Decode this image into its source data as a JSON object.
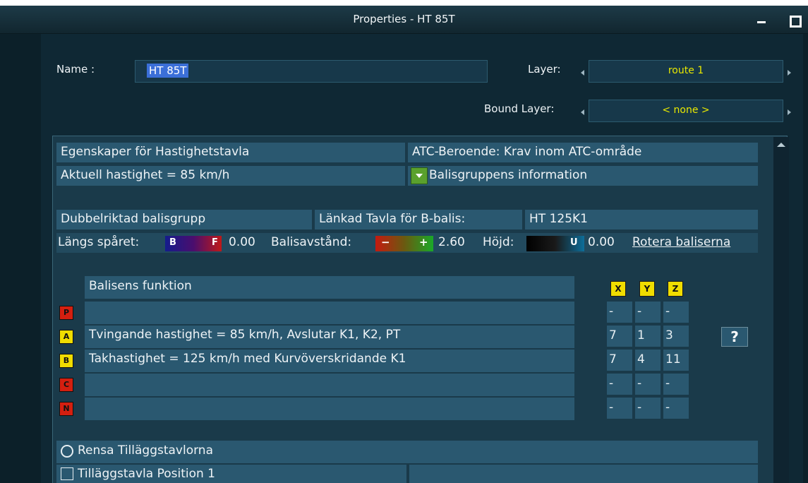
{
  "window": {
    "title": "Properties - HT 85T"
  },
  "header": {
    "name_label": "Name :",
    "name_value": "HT 85T",
    "layer_label": "Layer:",
    "layer_value": "route 1",
    "bound_layer_label": "Bound Layer:",
    "bound_layer_value": "< none >"
  },
  "sign": {
    "properties_title": "Egenskaper för Hastighetstavla",
    "atc_dependency": "ATC-Beroende:  Krav inom ATC-område",
    "current_speed": "Aktuell hastighet = 85 km/h",
    "balise_group_info": "Balisgruppens information",
    "double_direction": "Dubbelriktad balisgrupp",
    "linked_sign_label": "Länkad Tavla för B-balis:",
    "linked_sign_value": "HT 125K1",
    "along_track_label": "Längs spåret:",
    "along_track_value": "0.00",
    "balise_distance_label": "Balisavstånd:",
    "balise_distance_value": "2.60",
    "height_label": "Höjd:",
    "height_value": "0.00",
    "rotate_link": "Rotera baliserna"
  },
  "gradient_letters": {
    "b": "B",
    "f": "F",
    "minus": "−",
    "plus": "+",
    "u": "U"
  },
  "balise_table": {
    "header": "Balisens funktion",
    "axis_headers": [
      "X",
      "Y",
      "Z"
    ],
    "rows": [
      {
        "badge": "P",
        "text": "",
        "x": "-",
        "y": "-",
        "z": "-"
      },
      {
        "badge": "A",
        "text": "Tvingande hastighet = 85 km/h, Avslutar K1, K2, PT",
        "x": "7",
        "y": "1",
        "z": "3"
      },
      {
        "badge": "B",
        "text": "Takhastighet = 125 km/h med Kurvöverskridande K1",
        "x": "7",
        "y": "4",
        "z": "11"
      },
      {
        "badge": "C",
        "text": "",
        "x": "-",
        "y": "-",
        "z": "-"
      },
      {
        "badge": "N",
        "text": "",
        "x": "-",
        "y": "-",
        "z": "-"
      }
    ],
    "help_label": "?"
  },
  "footer": {
    "clear_additional": "Rensa Tilläggstavlorna",
    "additional_position_1": "Tilläggstavla Position 1"
  },
  "colors": {
    "window_bg": "#0c2029",
    "cell_bg": "#2a5870",
    "accent_yellow": "#f0dd00",
    "badge_red": "#d41f10",
    "selection_blue": "#3b6fd8",
    "dropdown_green": "#5aa12d"
  }
}
